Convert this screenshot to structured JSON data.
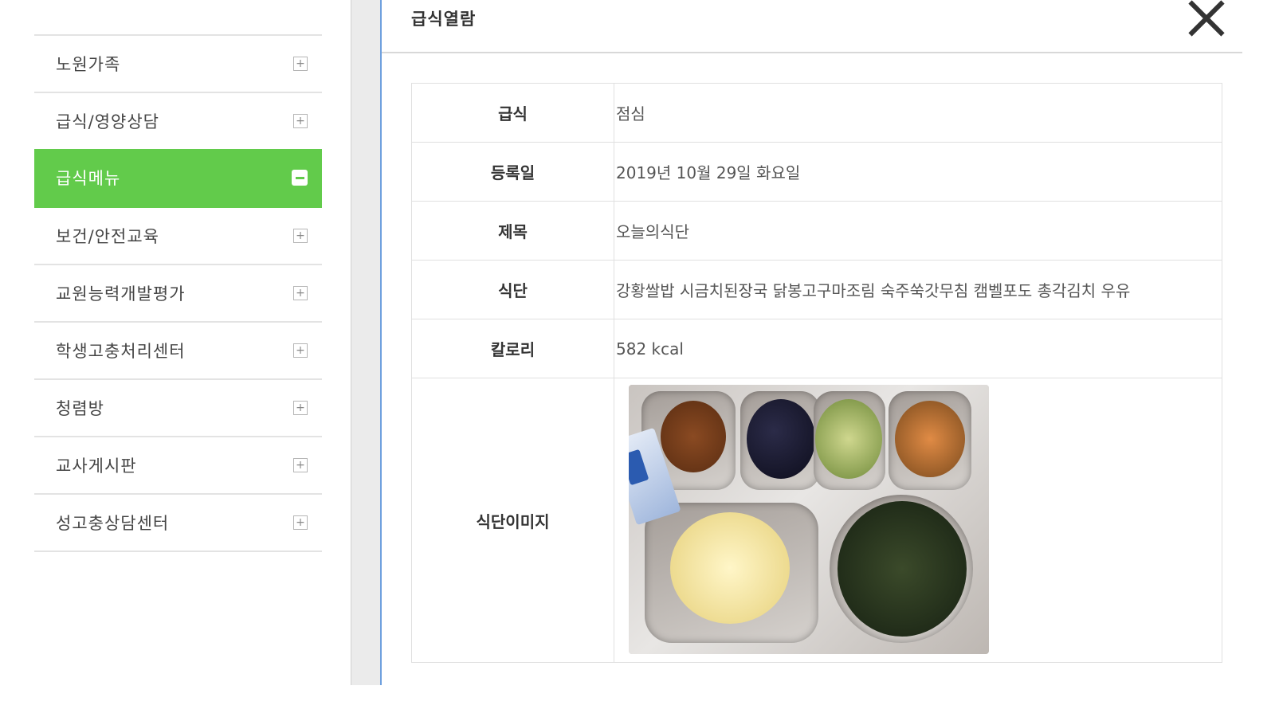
{
  "sidebar": {
    "items": [
      {
        "label": "노원가족",
        "active": false
      },
      {
        "label": "급식/영양상담",
        "active": false
      },
      {
        "label": "급식메뉴",
        "active": true
      },
      {
        "label": "보건/안전교육",
        "active": false
      },
      {
        "label": "교원능력개발평가",
        "active": false
      },
      {
        "label": "학생고충처리센터",
        "active": false
      },
      {
        "label": "청렴방",
        "active": false
      },
      {
        "label": "교사게시판",
        "active": false
      },
      {
        "label": "성고충상담센터",
        "active": false
      }
    ],
    "active_color": "#62cb4b"
  },
  "modal": {
    "title": "급식열람",
    "rows": {
      "meal": {
        "label": "급식",
        "value": "점심"
      },
      "date": {
        "label": "등록일",
        "value": "2019년 10월 29일 화요일"
      },
      "subject": {
        "label": "제목",
        "value": "오늘의식단"
      },
      "menu": {
        "label": "식단",
        "value": "강황쌀밥 시금치된장국 닭봉고구마조림 숙주쑥갓무침 캠벨포도 총각김치 우유"
      },
      "calories": {
        "label": "칼로리",
        "value": "582 kcal"
      },
      "image": {
        "label": "식단이미지"
      }
    }
  }
}
